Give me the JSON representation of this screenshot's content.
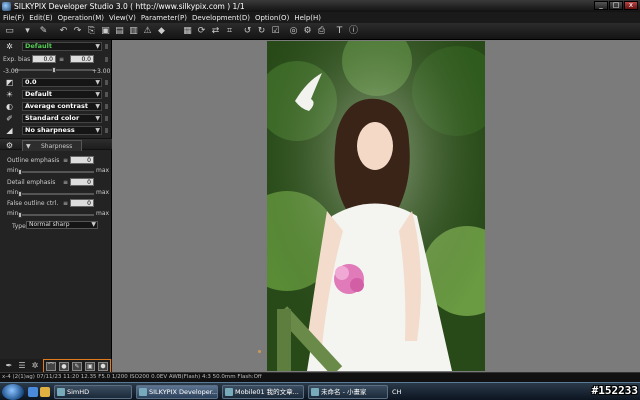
{
  "window": {
    "title": "SILKYPIX Developer Studio 3.0 ( http://www.silkypix.com )   1/1",
    "buttons": [
      "_",
      "□",
      "x"
    ]
  },
  "menu": [
    "File(F)",
    "Edit(E)",
    "Operation(M)",
    "View(V)",
    "Parameter(P)",
    "Development(D)",
    "Option(O)",
    "Help(H)"
  ],
  "panel": {
    "taste": "Default",
    "exp_bias_label": "Exp. bias",
    "exp_bias_value1": "0.0",
    "exp_bias_value2": "0.0",
    "exp_min": "-3.00",
    "exp_max": "+3.00",
    "contrast_value": "0.0",
    "white_balance": "Default",
    "contrast": "Average contrast",
    "color": "Standard color",
    "sharpness": "No sharpness",
    "section_title": "Sharpness",
    "outline_emphasis_label": "Outline emphasis",
    "outline_emphasis_value": "0",
    "detail_emphasis_label": "Detail emphasis",
    "detail_emphasis_value": "0",
    "false_outline_label": "False outline ctrl.",
    "false_outline_value": "0",
    "min": "min",
    "max": "max",
    "type_label": "Type",
    "type_value": "Normal sharp"
  },
  "status": "x-4 (2(1)ag) 07/11/23 11:20 12.35 F5.0 1/200 ISO200 0.0EV AWB(Flash) 4:3 50.0mm Flash:Off",
  "taskbar": {
    "tasks": [
      "SimHD",
      "SILKYPIX Developer...",
      "Mobile01 我的文章...",
      "未命名 - 小畫家"
    ],
    "tray_text": "CH",
    "watermark": "#152233"
  },
  "colors": {
    "accent_orange": "#e07a1c",
    "preview_bg": "#7b7b7b",
    "green_text": "#55cc55"
  }
}
